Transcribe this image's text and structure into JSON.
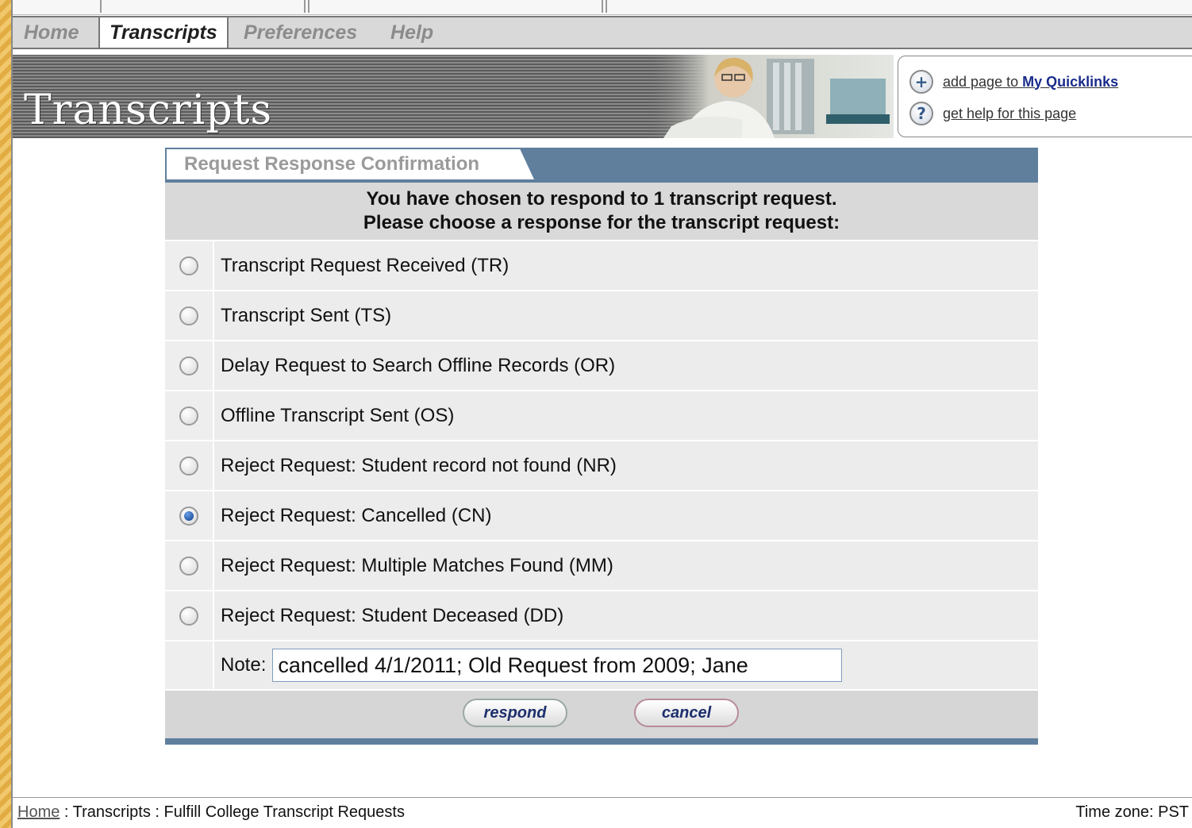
{
  "menu": {
    "items": [
      {
        "label": "Home"
      },
      {
        "label": "Transcripts"
      },
      {
        "label": "Preferences"
      },
      {
        "label": "Help"
      }
    ]
  },
  "banner": {
    "title": "Transcripts"
  },
  "quicklinks": {
    "add_prefix": "add page to ",
    "add_target": "My Quicklinks",
    "help_label": "get help for this page",
    "add_icon": "plus-icon",
    "help_icon": "question-icon"
  },
  "panel": {
    "tab_label": "Request Response Confirmation",
    "intro_line1": "You have chosen to respond to 1 transcript request.",
    "intro_line2": "Please choose a response for the transcript request:",
    "options": [
      {
        "label": "Transcript Request Received (TR)",
        "checked": false
      },
      {
        "label": "Transcript Sent (TS)",
        "checked": false
      },
      {
        "label": "Delay Request to Search Offline Records (OR)",
        "checked": false
      },
      {
        "label": "Offline Transcript Sent (OS)",
        "checked": false
      },
      {
        "label": "Reject Request: Student record not found (NR)",
        "checked": false
      },
      {
        "label": "Reject Request: Cancelled (CN)",
        "checked": true
      },
      {
        "label": "Reject Request: Multiple Matches Found (MM)",
        "checked": false
      },
      {
        "label": "Reject Request: Student Deceased (DD)",
        "checked": false
      }
    ],
    "note_label": "Note:",
    "note_value": "cancelled 4/1/2011; Old Request from 2009; Jane",
    "respond_label": "respond",
    "cancel_label": "cancel"
  },
  "footer": {
    "home_link": "Home",
    "crumb_rest": " : Transcripts : Fulfill College Transcript Requests",
    "timezone": "Time zone: PST"
  },
  "colors": {
    "accent": "#5f7f9d",
    "menu_bg": "#d9d9d9",
    "outer_bg": "#e9b54a"
  }
}
